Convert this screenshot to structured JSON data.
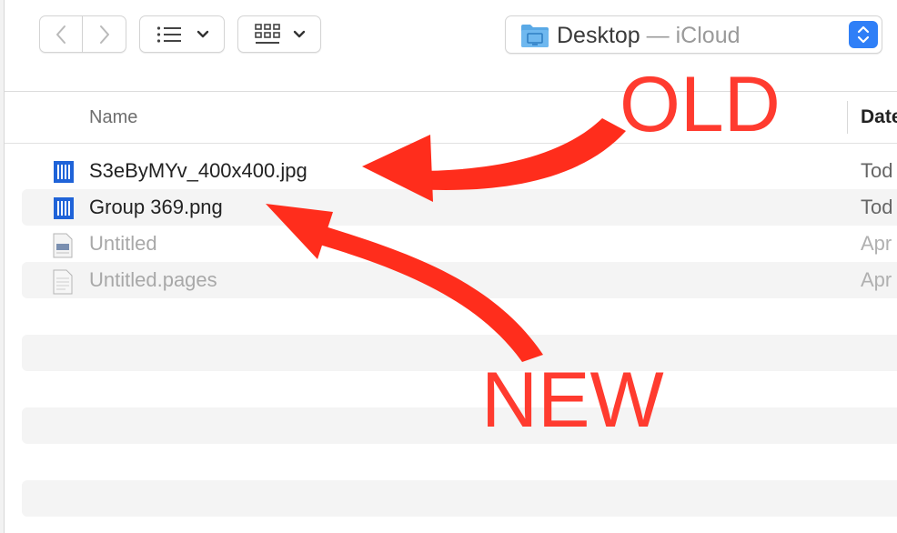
{
  "toolbar": {
    "back": "back-chevron",
    "forward": "forward-chevron",
    "view_icon": "list-view-icon",
    "group_icon": "grid-group-icon",
    "path": {
      "location": "Desktop",
      "separator": " — ",
      "cloud": "iCloud"
    }
  },
  "columns": {
    "name": "Name",
    "date": "Date"
  },
  "files": [
    {
      "name": "S3eByMYv_400x400.jpg",
      "date": "Tod",
      "icon": "image-file-icon",
      "dimmed": false
    },
    {
      "name": "Group 369.png",
      "date": "Tod",
      "icon": "image-file-icon",
      "dimmed": false
    },
    {
      "name": "Untitled",
      "date": "Apr",
      "icon": "document-preview-icon",
      "dimmed": true
    },
    {
      "name": "Untitled.pages",
      "date": "Apr",
      "icon": "pages-document-icon",
      "dimmed": true
    }
  ],
  "annotations": {
    "old": "OLD",
    "new": "NEW",
    "color": "#ff3b2f"
  },
  "colors": {
    "accent": "#2f7ff7",
    "file_icon_blue": "#1f63d8"
  }
}
